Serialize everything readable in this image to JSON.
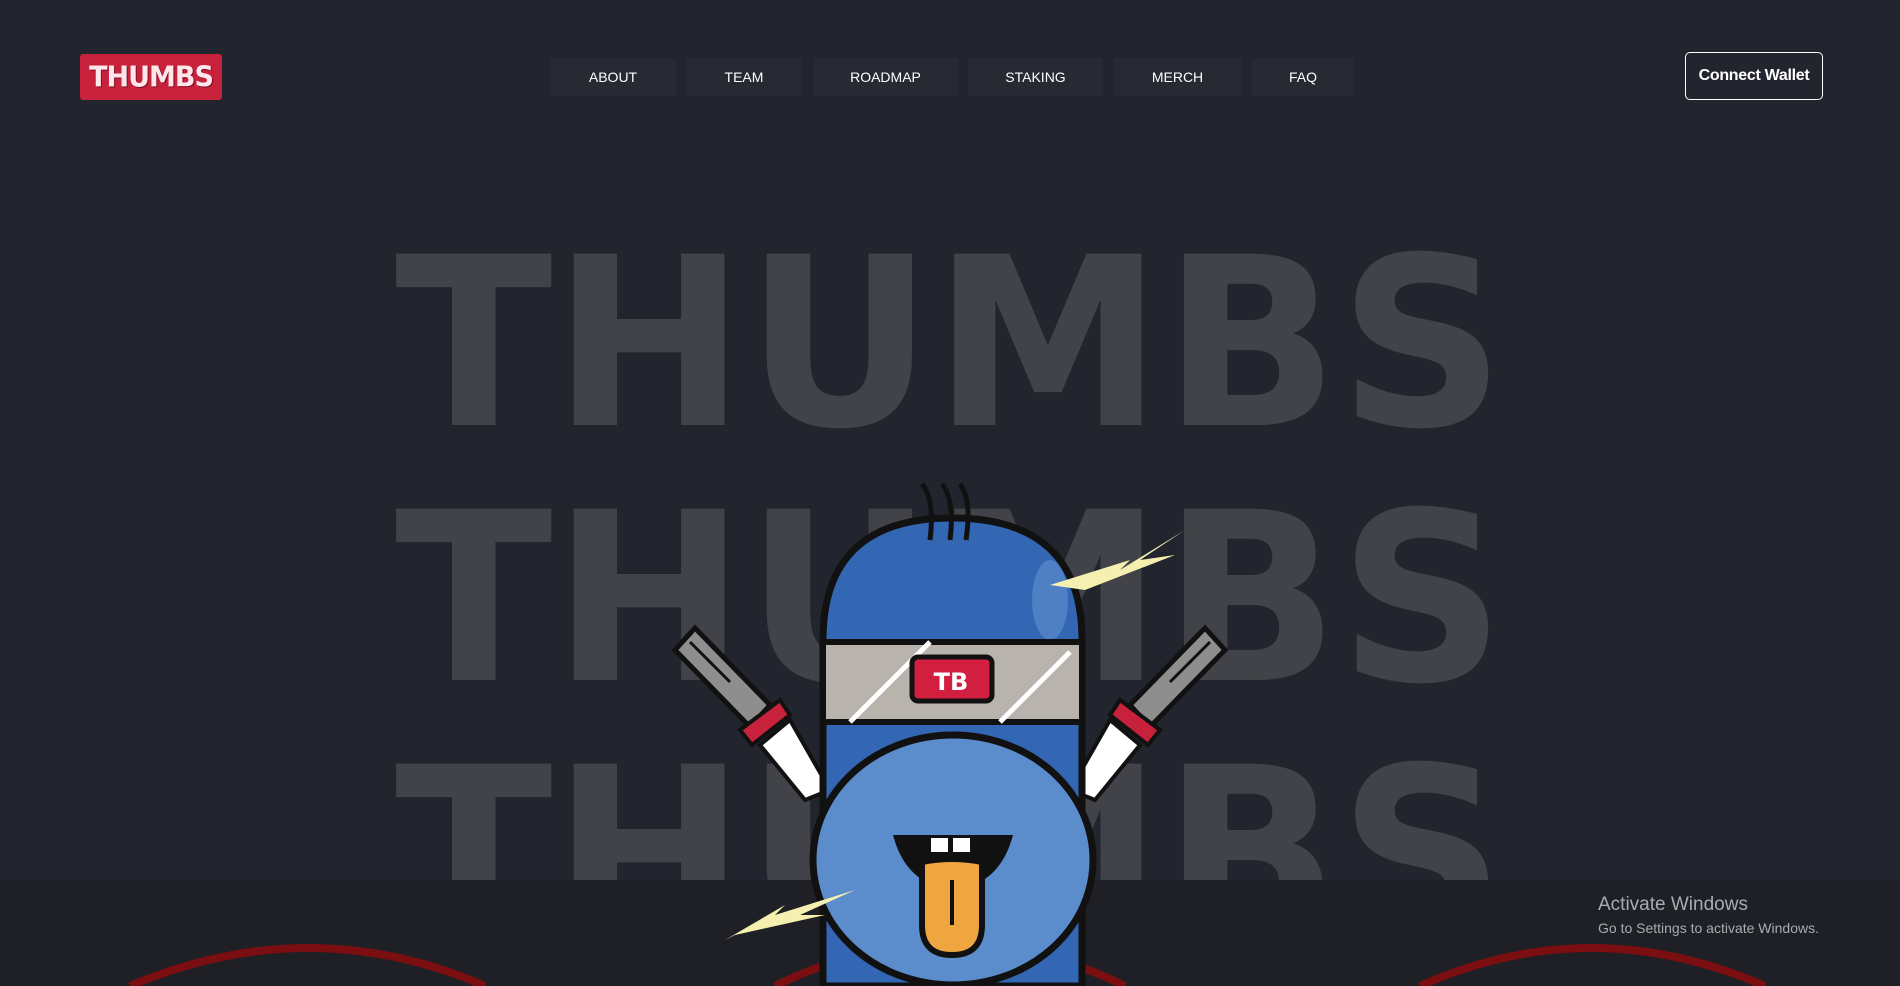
{
  "brand": {
    "logo_text": "THUMBS",
    "accent": "#c8213c"
  },
  "nav": {
    "items": [
      {
        "label": "ABOUT"
      },
      {
        "label": "TEAM"
      },
      {
        "label": "ROADMAP"
      },
      {
        "label": "STAKING"
      },
      {
        "label": "MERCH"
      },
      {
        "label": "FAQ"
      }
    ]
  },
  "header": {
    "connect_label": "Connect Wallet"
  },
  "hero": {
    "background_words": [
      "THUMBS",
      "THUMBS",
      "THUMBS"
    ],
    "headband_badge": "TB"
  },
  "os_overlay": {
    "activate_title": "Activate Windows",
    "activate_subtitle": "Go to Settings to activate Windows."
  },
  "colors": {
    "page_bg": "#22252d",
    "mascot_blue": "#3366b3",
    "mascot_light_blue": "#5b8ccb",
    "tongue": "#f0a640",
    "lightning": "#f6f0b0"
  }
}
